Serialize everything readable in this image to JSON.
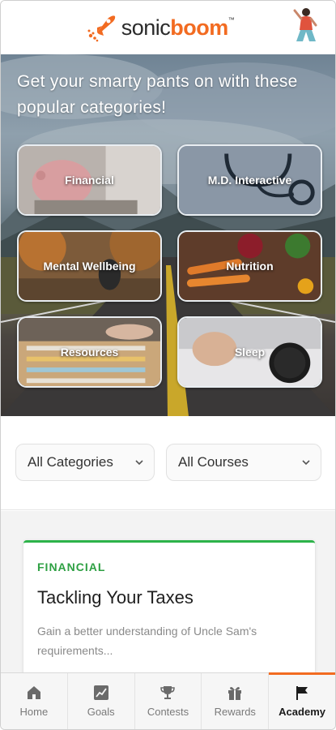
{
  "brand": {
    "name_part1": "sonic",
    "name_part2": "boom",
    "tm": "™",
    "accent": "#f26b21"
  },
  "hero": {
    "title": "Get your smarty pants on with these popular categories!",
    "tiles": [
      {
        "label": "Financial"
      },
      {
        "label": "M.D. Interactive"
      },
      {
        "label": "Mental Wellbeing"
      },
      {
        "label": "Nutrition"
      },
      {
        "label": "Resources"
      },
      {
        "label": "Sleep"
      }
    ]
  },
  "filters": {
    "category": {
      "value": "All Categories"
    },
    "course": {
      "value": "All Courses"
    }
  },
  "course_card": {
    "category": "FINANCIAL",
    "title": "Tackling Your Taxes",
    "description": "Gain a better understanding of Uncle Sam's requirements...",
    "accent": "#2db34a"
  },
  "nav": {
    "items": [
      {
        "label": "Home",
        "icon": "home-icon"
      },
      {
        "label": "Goals",
        "icon": "chart-icon"
      },
      {
        "label": "Contests",
        "icon": "trophy-icon"
      },
      {
        "label": "Rewards",
        "icon": "gift-icon"
      },
      {
        "label": "Academy",
        "icon": "flag-icon",
        "active": true
      }
    ]
  }
}
